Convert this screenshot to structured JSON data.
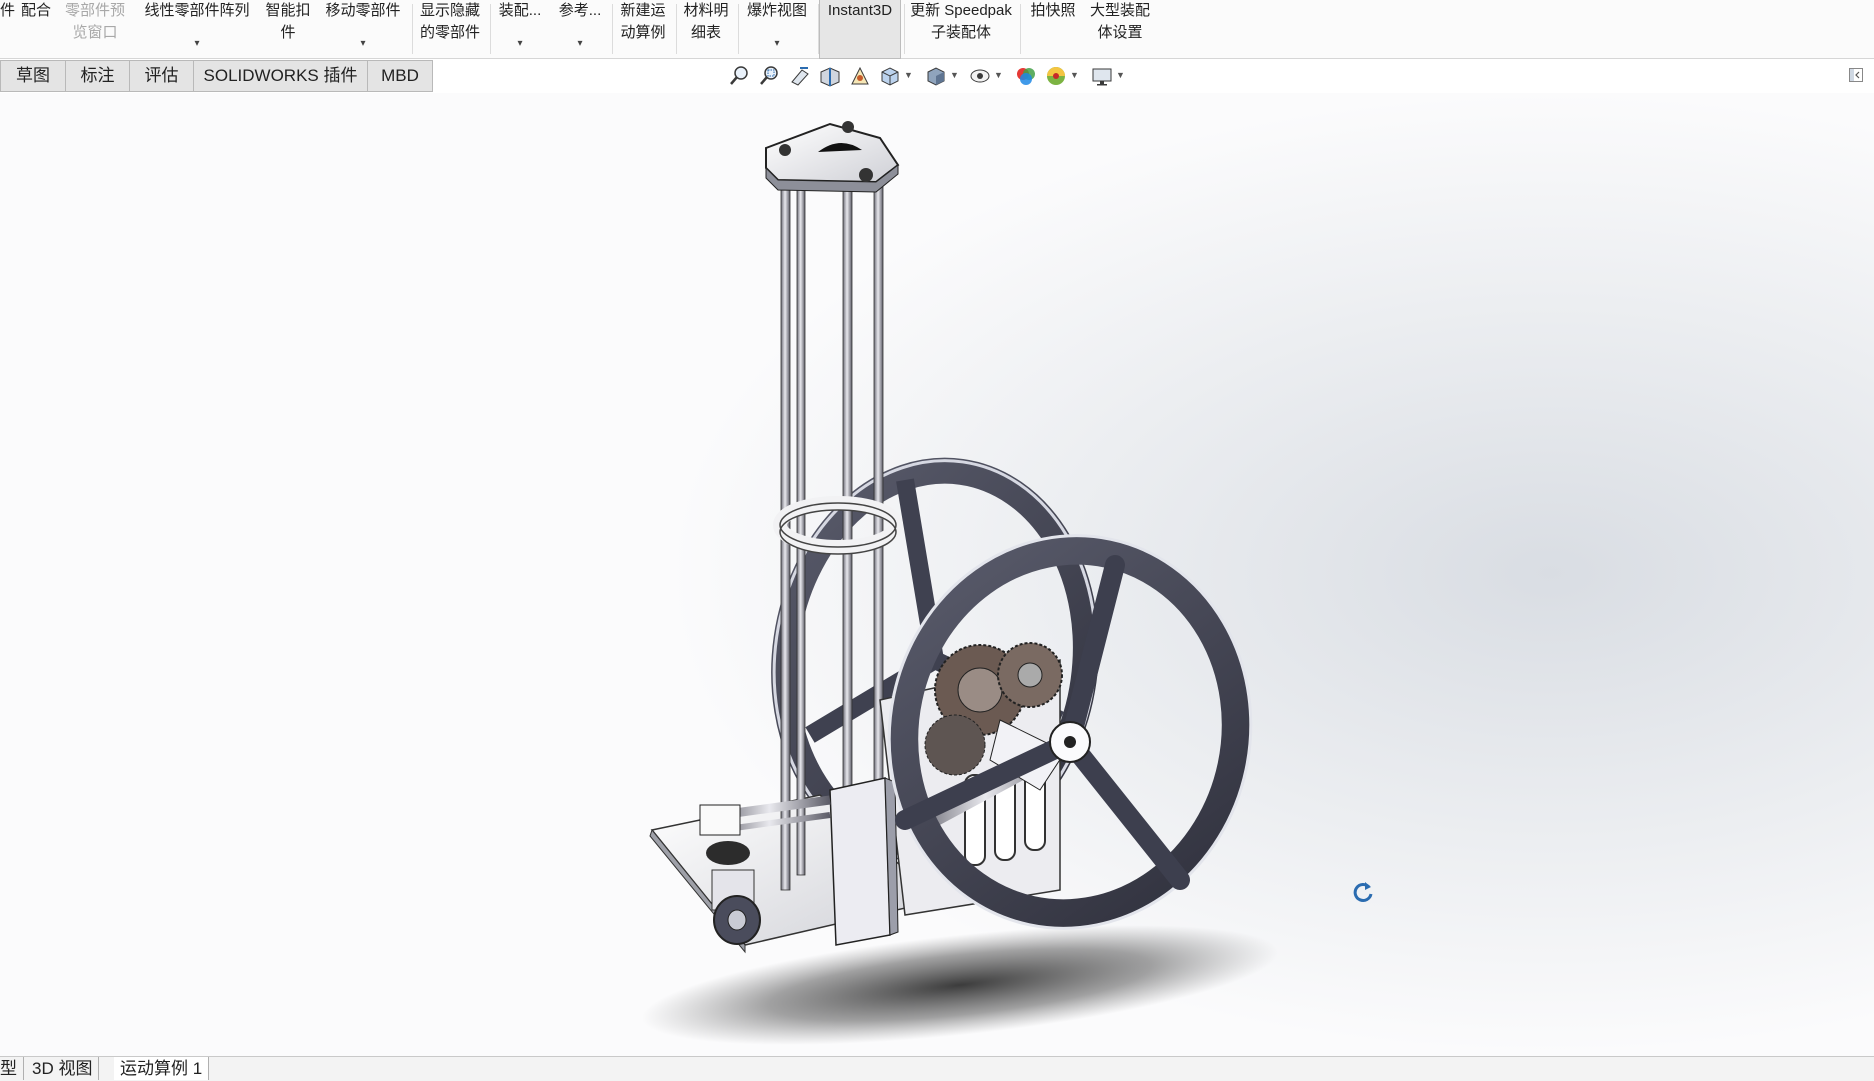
{
  "ribbon": {
    "items": [
      {
        "l1": "件",
        "l2": "",
        "arrow": false,
        "disabled": false
      },
      {
        "l1": "配合",
        "l2": "",
        "arrow": false,
        "disabled": false
      },
      {
        "l1": "零部件预",
        "l2": "览窗口",
        "arrow": false,
        "disabled": true
      },
      {
        "l1": "线性零部件阵列",
        "l2": "",
        "arrow": true,
        "disabled": false
      },
      {
        "l1": "智能扣",
        "l2": "件",
        "arrow": false,
        "disabled": false
      },
      {
        "l1": "移动零部件",
        "l2": "",
        "arrow": true,
        "disabled": false
      },
      {
        "l1": "显示隐藏",
        "l2": "的零部件",
        "arrow": false,
        "disabled": false
      },
      {
        "l1": "装配...",
        "l2": "",
        "arrow": true,
        "disabled": false
      },
      {
        "l1": "参考...",
        "l2": "",
        "arrow": true,
        "disabled": false
      },
      {
        "l1": "新建运",
        "l2": "动算例",
        "arrow": false,
        "disabled": false
      },
      {
        "l1": "材料明",
        "l2": "细表",
        "arrow": false,
        "disabled": false
      },
      {
        "l1": "爆炸视图",
        "l2": "",
        "arrow": true,
        "disabled": false
      },
      {
        "l1": "Instant3D",
        "l2": "",
        "arrow": false,
        "disabled": false,
        "active": true
      },
      {
        "l1": "更新 Speedpak",
        "l2": "子装配体",
        "arrow": false,
        "disabled": false
      },
      {
        "l1": "拍快照",
        "l2": "",
        "arrow": false,
        "disabled": false
      },
      {
        "l1": "大型装配",
        "l2": "体设置",
        "arrow": false,
        "disabled": false
      }
    ]
  },
  "command_tabs": [
    "草图",
    "标注",
    "评估",
    "SOLIDWORKS 插件",
    "MBD"
  ],
  "hud_icons": [
    "zoom-to-fit-icon",
    "zoom-to-area-icon",
    "previous-view-icon",
    "section-view-icon",
    "dynamic-annotation-icon",
    "view-orientation-icon",
    "display-style-icon",
    "hide-show-items-icon",
    "edit-appearance-icon",
    "apply-scene-icon",
    "view-settings-icon"
  ],
  "bottom_tabs": [
    "型",
    "3D 视图",
    "运动算例 1"
  ],
  "colors": {
    "flywheel": "#4a4c5c",
    "ribbon_bg": "#fbfbfb",
    "tab_bg": "#e4e4e4",
    "rotate_icon": "#2b6cb0"
  }
}
